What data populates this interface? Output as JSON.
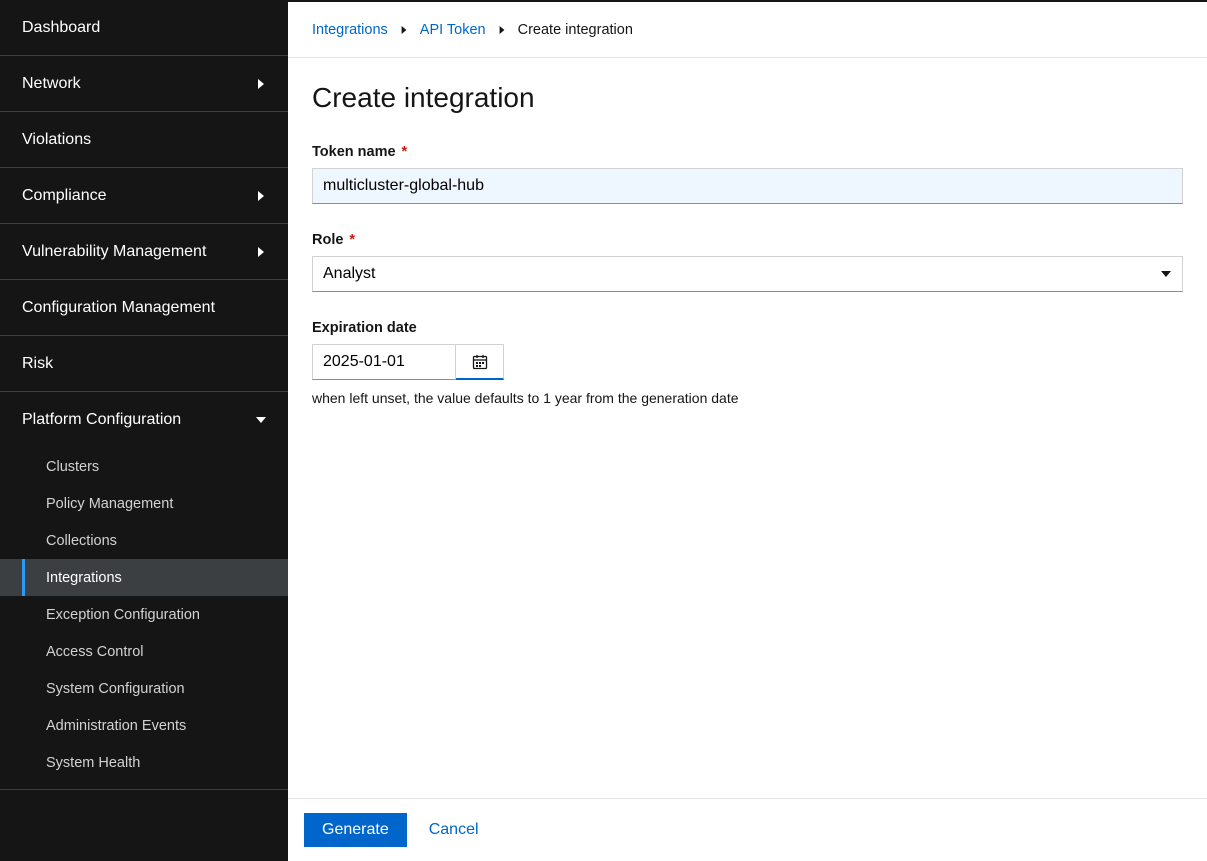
{
  "sidebar": {
    "items": [
      {
        "label": "Dashboard",
        "expandable": false
      },
      {
        "label": "Network",
        "expandable": true
      },
      {
        "label": "Violations",
        "expandable": false
      },
      {
        "label": "Compliance",
        "expandable": true
      },
      {
        "label": "Vulnerability Management",
        "expandable": true
      },
      {
        "label": "Configuration Management",
        "expandable": false
      },
      {
        "label": "Risk",
        "expandable": false
      },
      {
        "label": "Platform Configuration",
        "expandable": true,
        "expanded": true
      }
    ],
    "subitems": [
      {
        "label": "Clusters"
      },
      {
        "label": "Policy Management"
      },
      {
        "label": "Collections"
      },
      {
        "label": "Integrations",
        "active": true
      },
      {
        "label": "Exception Configuration"
      },
      {
        "label": "Access Control"
      },
      {
        "label": "System Configuration"
      },
      {
        "label": "Administration Events"
      },
      {
        "label": "System Health"
      }
    ]
  },
  "breadcrumb": {
    "a": "Integrations",
    "b": "API Token",
    "c": "Create integration"
  },
  "page": {
    "title": "Create integration"
  },
  "form": {
    "token_name": {
      "label": "Token name",
      "value": "multicluster-global-hub"
    },
    "role": {
      "label": "Role",
      "value": "Analyst"
    },
    "expiration": {
      "label": "Expiration date",
      "value": "2025-01-01",
      "help": "when left unset, the value defaults to 1 year from the generation date"
    }
  },
  "footer": {
    "generate": "Generate",
    "cancel": "Cancel"
  }
}
